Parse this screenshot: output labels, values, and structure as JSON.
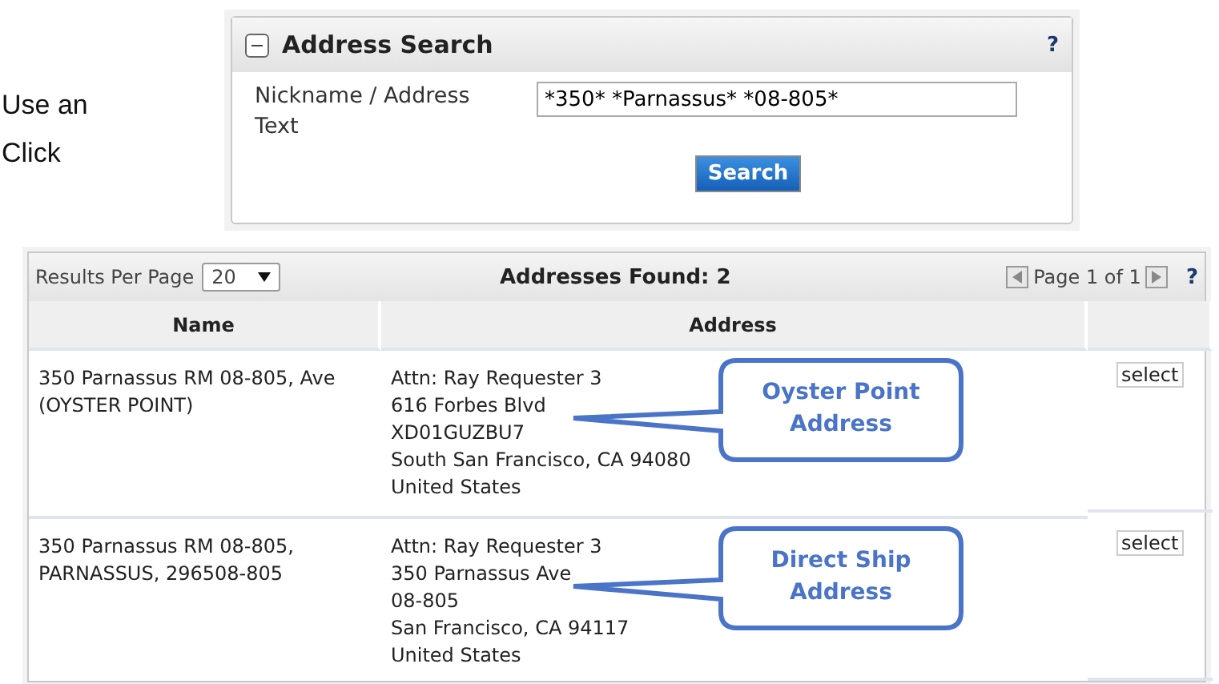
{
  "side_text": [
    "Use an",
    "Click"
  ],
  "search_panel": {
    "title": "Address Search",
    "expanded": true,
    "help": "?",
    "field_label": "Nickname / Address Text",
    "field_value": "*350* *Parnassus* *08-805*",
    "button": "Search"
  },
  "results": {
    "per_page_label": "Results Per Page",
    "per_page_value": "20",
    "found": "Addresses Found: 2",
    "page_info": "Page 1 of 1",
    "help": "?",
    "columns": [
      "Name",
      "Address"
    ],
    "rows": [
      {
        "name": "350 Parnassus RM 08-805, Ave (OYSTER POINT)",
        "address": [
          "Attn: Ray Requester 3",
          "616 Forbes Blvd",
          "XD01GUZBU7",
          "South San Francisco, CA 94080",
          "United States"
        ],
        "action": "select",
        "callout": "Oyster Point Address"
      },
      {
        "name": "350 Parnassus RM 08-805, PARNASSUS, 296508-805",
        "address": [
          "Attn: Ray Requester 3",
          "350 Parnassus Ave",
          "08-805",
          "San Francisco, CA 94117",
          "United States"
        ],
        "action": "select",
        "callout": "Direct Ship Address"
      }
    ]
  }
}
